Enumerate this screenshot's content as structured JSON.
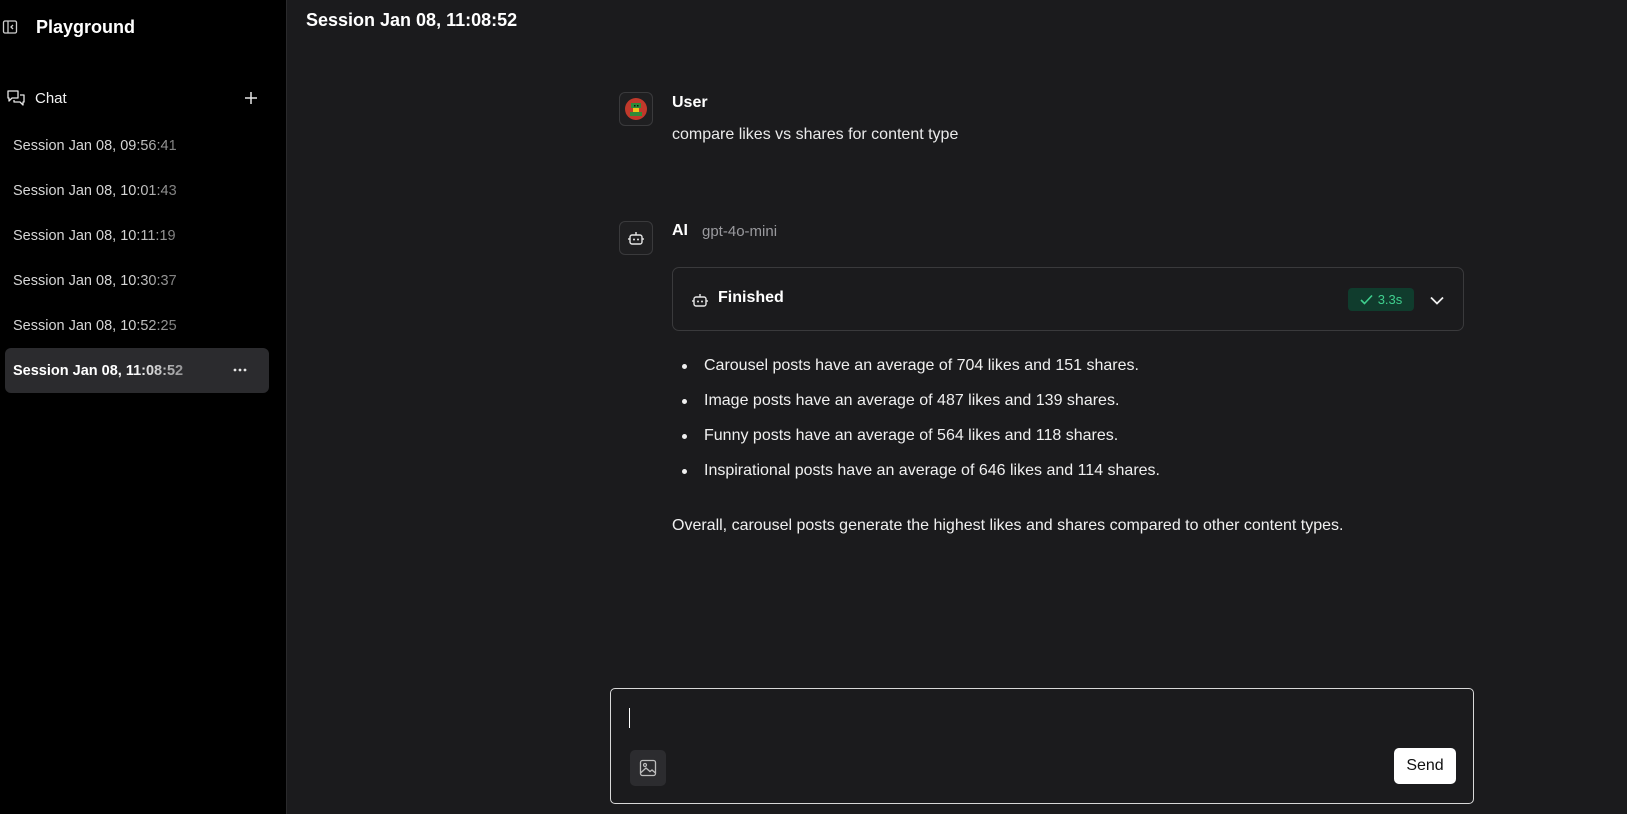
{
  "sidebar": {
    "title": "Playground",
    "toggle_icon": "sidebar-toggle-icon",
    "section_label": "Chat",
    "new_chat_icon": "plus-icon",
    "sessions": [
      {
        "label": "Session Jan 08, 09:56:41"
      },
      {
        "label": "Session Jan 08, 10:01:43"
      },
      {
        "label": "Session Jan 08, 10:11:19"
      },
      {
        "label": "Session Jan 08, 10:30:37"
      },
      {
        "label": "Session Jan 08, 10:52:25"
      },
      {
        "label": "Session Jan 08, 11:08:52",
        "active": true
      }
    ],
    "more_icon": "more-horizontal-icon"
  },
  "main": {
    "title": "Session Jan 08, 11:08:52",
    "user_message": {
      "author": "User",
      "text": "compare likes vs shares for content type"
    },
    "ai_message": {
      "author": "AI",
      "model": "gpt-4o-mini",
      "status_label": "Finished",
      "duration": "3.3s",
      "bullets": [
        "Carousel posts have an average of 704 likes and 151 shares.",
        "Image posts have an average of 487 likes and 139 shares.",
        "Funny posts have an average of 564 likes and 118 shares.",
        "Inspirational posts have an average of 646 likes and 114 shares."
      ],
      "summary": "Overall, carousel posts generate the highest likes and shares compared to other content types."
    }
  },
  "composer": {
    "value": "",
    "placeholder": "",
    "image_icon": "image-upload-icon",
    "send_label": "Send"
  },
  "colors": {
    "background": "#1b1b1d",
    "sidebar": "#000000",
    "active_session": "#2b2b2e",
    "success_badge_bg": "#103c2d",
    "success_text": "#3fcf8e"
  }
}
